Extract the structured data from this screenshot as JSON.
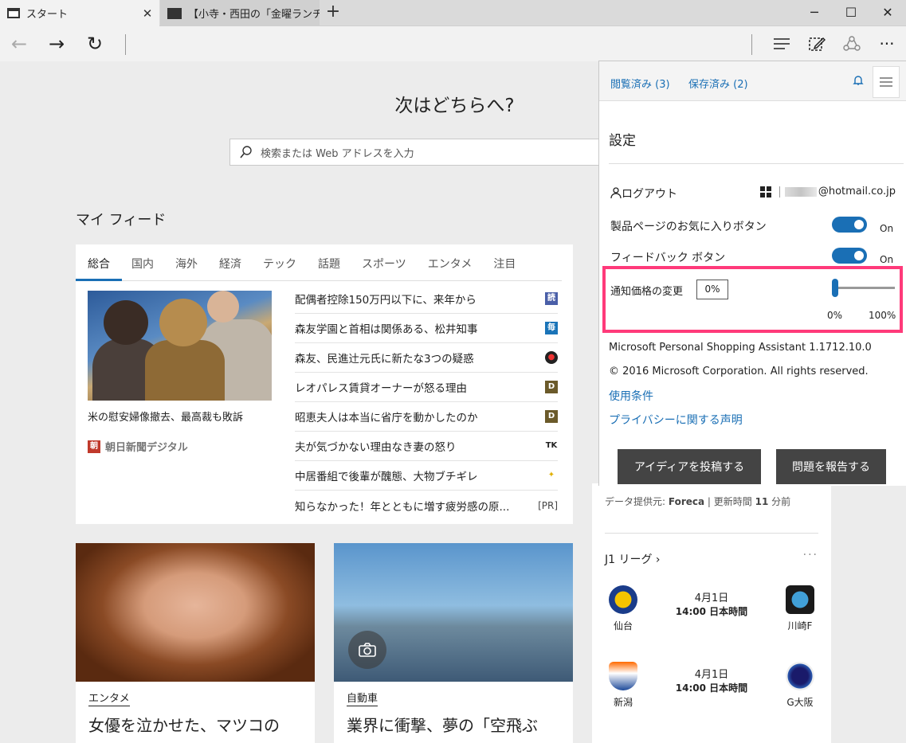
{
  "tabs": [
    {
      "label": "スタート",
      "close": "✕"
    },
    {
      "label": "【小寺・西田の「金曜ランチビュッ"
    }
  ],
  "newtab": "+",
  "window_controls": {
    "minimize": "─",
    "maximize": "☐",
    "close": "✕"
  },
  "nav": {
    "back": "←",
    "forward": "→",
    "refresh": "↻",
    "more": "···"
  },
  "main": {
    "heading": "次はどちらへ?",
    "search_placeholder": "検索または Web アドレスを入力",
    "myfeed": "マイ フィード"
  },
  "feed": {
    "categories": [
      "総合",
      "国内",
      "海外",
      "経済",
      "テック",
      "話題",
      "スポーツ",
      "エンタメ",
      "注目"
    ],
    "lead": {
      "caption": "米の慰安婦像撤去、最高裁も敗訴",
      "source_logo": "朝",
      "source": "朝日新聞デジタル"
    },
    "headlines": [
      {
        "title": "配偶者控除150万円以下に、来年から",
        "badge": "読",
        "color": "#4a5fa8"
      },
      {
        "title": "森友学園と首相は関係ある、松井知事",
        "badge": "毎",
        "color": "#1a74b8"
      },
      {
        "title": "森友、民進辻元氏に新たな3つの疑惑",
        "badge": "●",
        "color": "#c0392b"
      },
      {
        "title": "レオパレス賃貸オーナーが怒る理由",
        "badge": "D",
        "color": "#6b5a2a"
      },
      {
        "title": "昭恵夫人は本当に省庁を動かしたのか",
        "badge": "D",
        "color": "#6b5a2a"
      },
      {
        "title": "夫が気づかない理由なき妻の怒り",
        "badge": "TK",
        "color": "#222222"
      },
      {
        "title": "中居番組で後輩が醜態、大物ブチギレ",
        "badge": "✦",
        "color": "#e0b000"
      },
      {
        "title": "知らなかった！年とともに増す疲労感の原...",
        "badge": "[PR]",
        "color": ""
      }
    ]
  },
  "cards": [
    {
      "category": "エンタメ",
      "title": "女優を泣かせた、マツコの"
    },
    {
      "category": "自動車",
      "title": "業界に衝撃、夢の「空飛ぶ"
    }
  ],
  "weather": {
    "provider_prefix": "データ提供元: ",
    "provider": "Foreca",
    "update": " | 更新時間 ",
    "update_hours": "11",
    "update_suffix": " 分前"
  },
  "j1": {
    "title": "J1 リーグ ›",
    "more": "···",
    "matches": [
      {
        "home": "仙台",
        "away": "川崎F",
        "date": "4月1日",
        "time": "14:00 日本時間"
      },
      {
        "home": "新潟",
        "away": "G大阪",
        "date": "4月1日",
        "time": "14:00 日本時間"
      }
    ]
  },
  "panel": {
    "tab_history": "閲覧済み (3)",
    "tab_saved": "保存済み (2)",
    "settings_title": "設定",
    "logout": "ログアウト",
    "account": "@hotmail.co.jp",
    "fav_button": "製品ページのお気に入りボタン",
    "fav_state": "On",
    "feedback_button": "フィードバック ボタン",
    "feedback_state": "On",
    "price_change": "通知価格の変更",
    "price_value": "0%",
    "slider_min": "0%",
    "slider_max": "100%",
    "slider_level": 0,
    "product": "Microsoft Personal Shopping Assistant 1.1712.10.0",
    "copyright": "© 2016 Microsoft Corporation. All rights reserved.",
    "terms": "使用条件",
    "privacy": "プライバシーに関する声明",
    "post_idea": "アイディアを投稿する",
    "report_issue": "問題を報告する"
  },
  "colors": {
    "accent": "#1a6fb5",
    "highlight": "#ff3a7a"
  }
}
